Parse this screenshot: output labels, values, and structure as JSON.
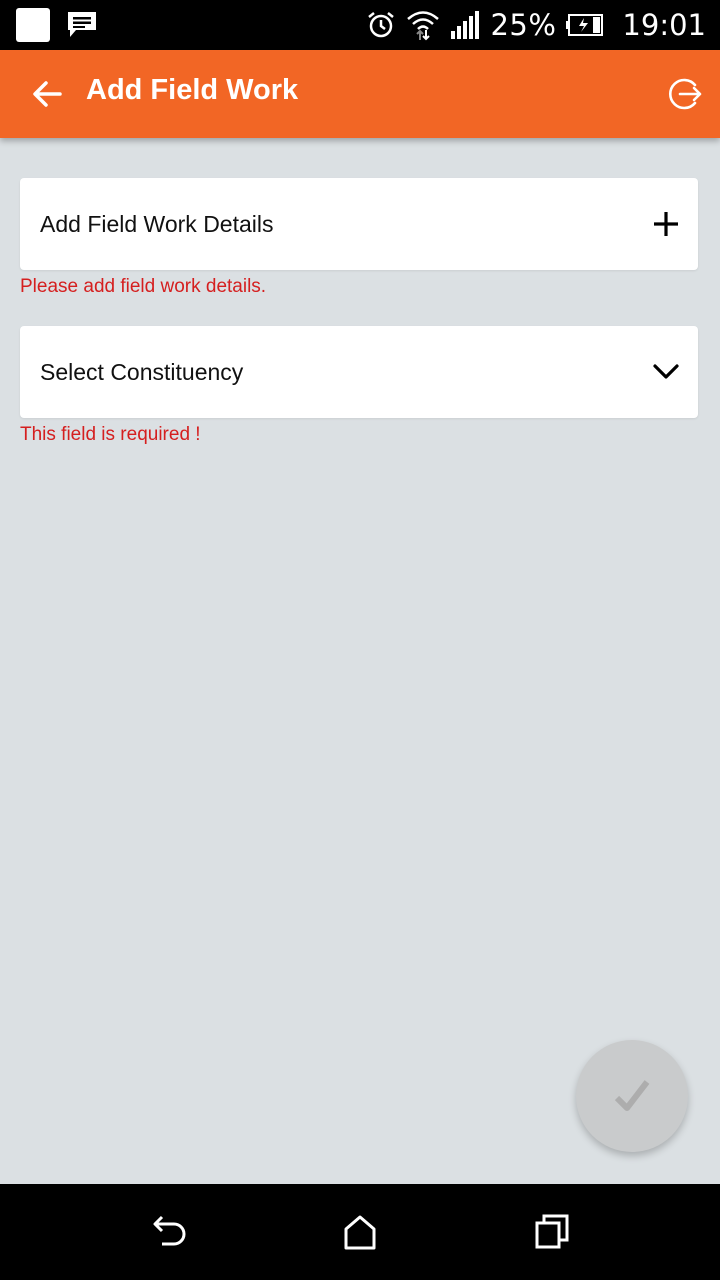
{
  "status_bar": {
    "battery_percent": "25%",
    "time": "19:01",
    "icons": [
      "app-icon",
      "message-icon",
      "alarm-icon",
      "wifi-icon",
      "signal-icon",
      "battery-icon"
    ]
  },
  "app_bar": {
    "title": "Add Field Work",
    "back_icon": "arrow-left-icon",
    "logout_icon": "logout-icon",
    "background": "#f26625"
  },
  "form": {
    "details_card": {
      "label": "Add Field Work Details",
      "icon": "plus-icon",
      "error": "Please add field work details."
    },
    "constituency_select": {
      "label": "Select Constituency",
      "icon": "chevron-down-icon",
      "error": "This field is required !"
    }
  },
  "fab": {
    "icon": "check-icon",
    "state": "disabled"
  },
  "nav_bar": {
    "buttons": [
      "back-nav-icon",
      "home-nav-icon",
      "recents-nav-icon"
    ]
  },
  "colors": {
    "accent": "#f26625",
    "error": "#d51f1f",
    "background": "#dbe0e3"
  }
}
